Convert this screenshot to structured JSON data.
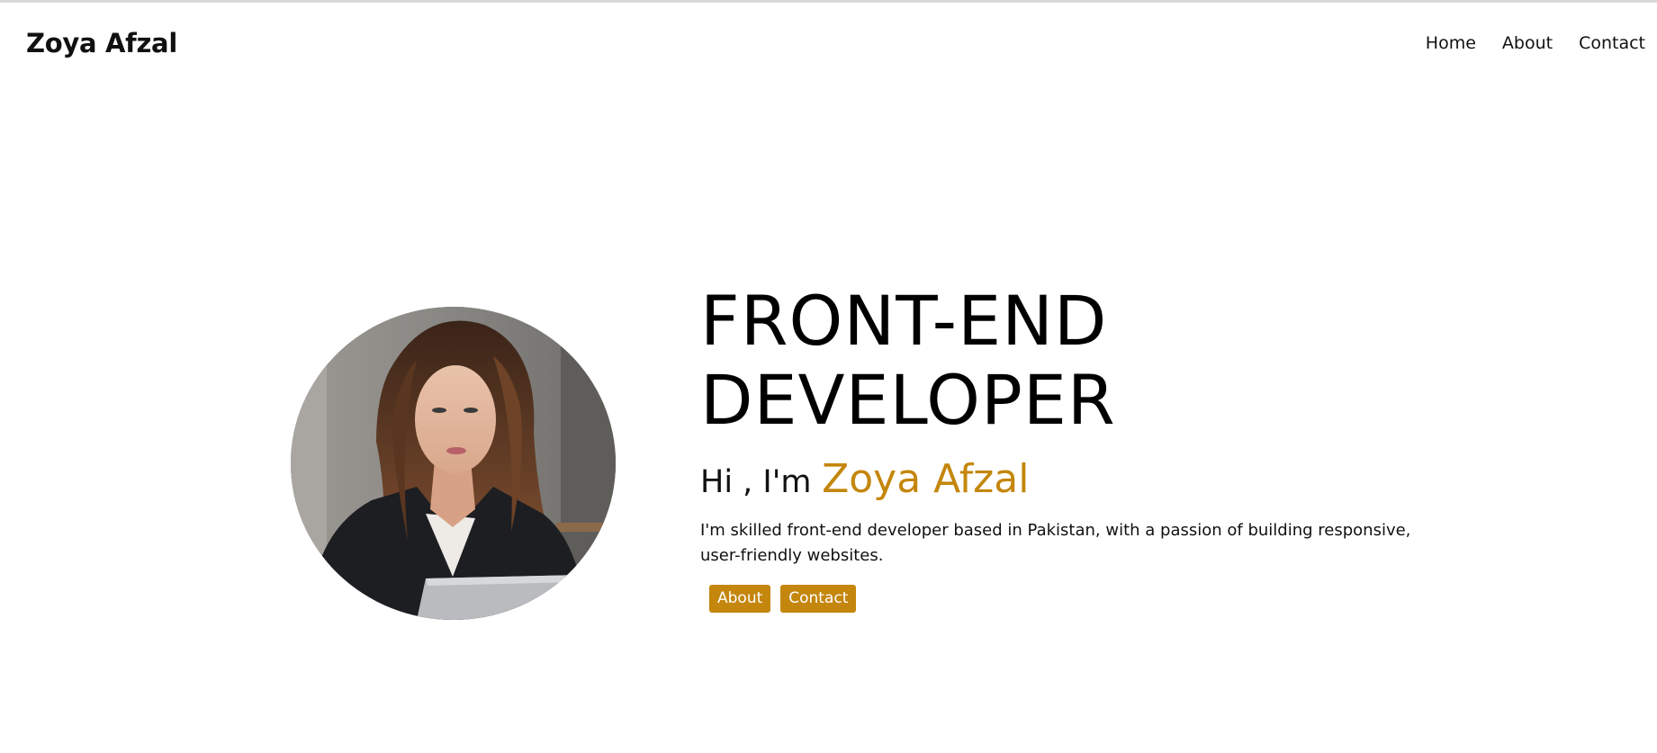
{
  "header": {
    "brand": "Zoya Afzal",
    "nav": [
      {
        "label": "Home"
      },
      {
        "label": "About"
      },
      {
        "label": "Contact"
      }
    ]
  },
  "hero": {
    "title_line1": "FRONT-END",
    "title_line2": "DEVELOPER",
    "greeting_prefix": "Hi , I'm",
    "greeting_name": "Zoya Afzal",
    "description": "I'm skilled front-end developer based in Pakistan, with a passion of building responsive, user-friendly websites.",
    "buttons": {
      "about": "About",
      "contact": "Contact"
    }
  },
  "colors": {
    "accent": "#c4860c",
    "text": "#111111",
    "background": "#ffffff"
  },
  "images": {
    "profile": "portrait photo of woman with long brown hair in dark blazer at laptop"
  }
}
